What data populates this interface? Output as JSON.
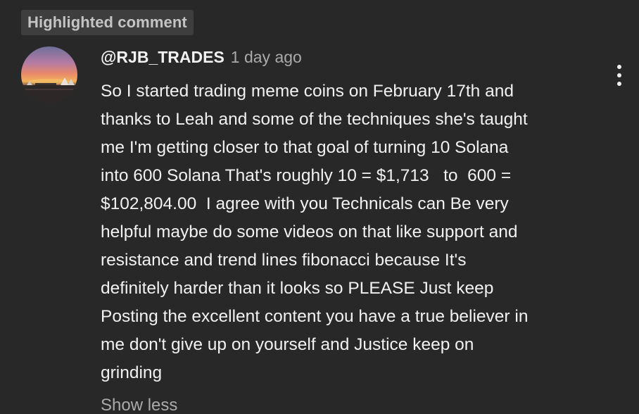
{
  "badge": {
    "label": "Highlighted comment"
  },
  "comment": {
    "author": "@RJB_TRADES",
    "timestamp": "1 day ago",
    "avatar": "sunset-avatar-image",
    "menu_icon": "more-vert-icon",
    "lines": [
      "So I started trading meme coins on February 17th and",
      "thanks to Leah and some of the techniques she's taught",
      "me I'm getting closer to that goal of turning 10 Solana",
      "into 600 Solana That's roughly 10 = $1,713   to  600 =",
      "$102,804.00  I agree with you Technicals can Be very",
      "helpful maybe do some videos on that like support and",
      "resistance and trend lines fibonacci because It's",
      "definitely harder than it looks so PLEASE Just keep",
      "Posting the excellent content you have a true believer in",
      "me don't give up on yourself and Justice keep on",
      "grinding"
    ],
    "show_less_label": "Show less"
  },
  "colors": {
    "background": "#282828",
    "badge_background": "#3e3e3e",
    "badge_text": "#c4c4c4",
    "primary_text": "#f1f1f1",
    "secondary_text": "#aaaaaa"
  }
}
